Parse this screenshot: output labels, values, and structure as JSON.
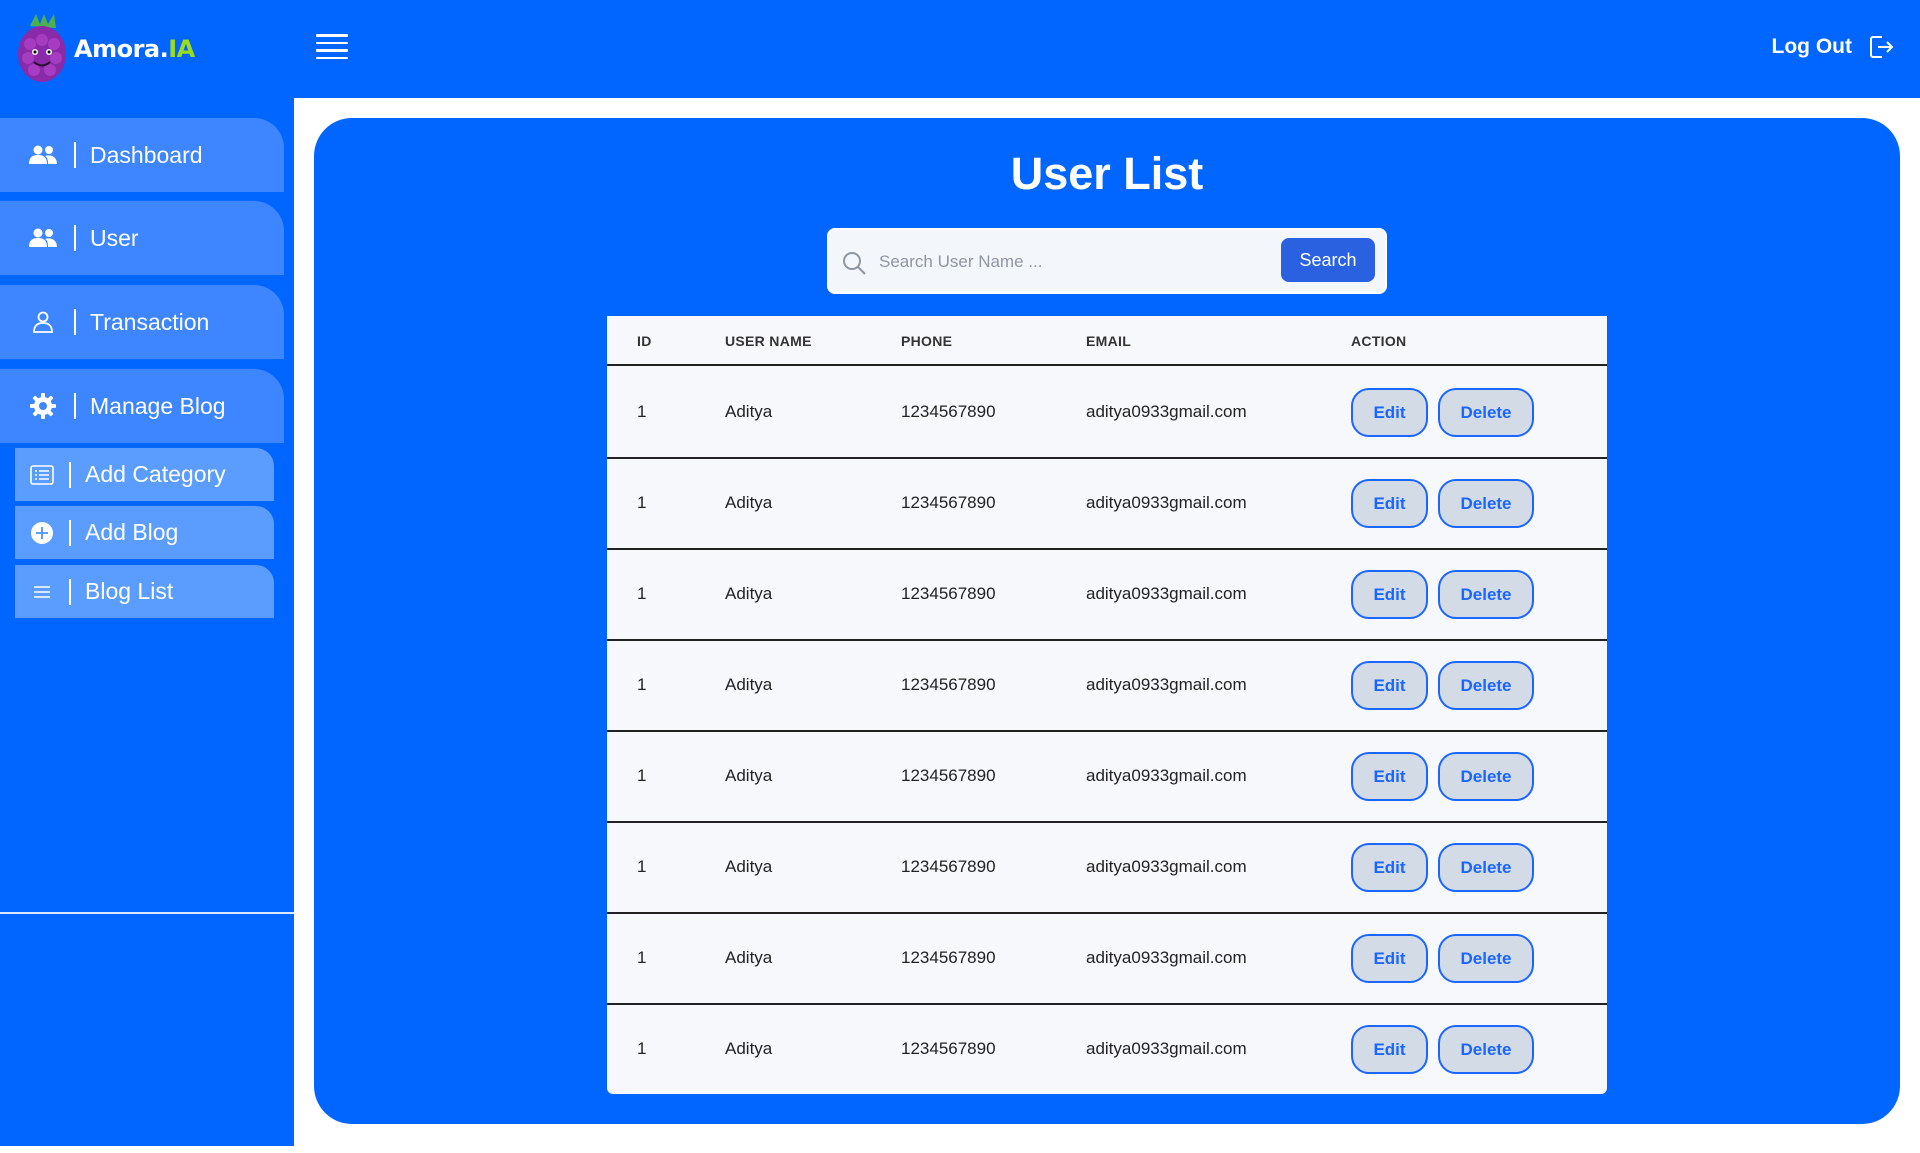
{
  "app": {
    "name_main": "Amora.",
    "name_accent": "IA"
  },
  "header": {
    "logout_label": "Log Out"
  },
  "sidebar": {
    "items": [
      {
        "label": "Dashboard",
        "icon": "users-icon"
      },
      {
        "label": "User",
        "icon": "users-icon"
      },
      {
        "label": "Transaction",
        "icon": "user-icon"
      },
      {
        "label": "Manage Blog",
        "icon": "gear-icon"
      }
    ],
    "sub_items": [
      {
        "label": "Add Category",
        "icon": "list-box-icon"
      },
      {
        "label": "Add Blog",
        "icon": "plus-circle-icon"
      },
      {
        "label": "Blog List",
        "icon": "menu-lines-icon"
      }
    ]
  },
  "main": {
    "title": "User List",
    "search": {
      "placeholder": "Search User Name ...",
      "value": "",
      "button_label": "Search"
    },
    "table": {
      "columns": [
        "ID",
        "USER NAME",
        "PHONE",
        "EMAIL",
        "ACTION"
      ],
      "rows": [
        {
          "id": "1",
          "name": "Aditya",
          "phone": "1234567890",
          "email": "aditya0933gmail.com"
        },
        {
          "id": "1",
          "name": "Aditya",
          "phone": "1234567890",
          "email": "aditya0933gmail.com"
        },
        {
          "id": "1",
          "name": "Aditya",
          "phone": "1234567890",
          "email": "aditya0933gmail.com"
        },
        {
          "id": "1",
          "name": "Aditya",
          "phone": "1234567890",
          "email": "aditya0933gmail.com"
        },
        {
          "id": "1",
          "name": "Aditya",
          "phone": "1234567890",
          "email": "aditya0933gmail.com"
        },
        {
          "id": "1",
          "name": "Aditya",
          "phone": "1234567890",
          "email": "aditya0933gmail.com"
        },
        {
          "id": "1",
          "name": "Aditya",
          "phone": "1234567890",
          "email": "aditya0933gmail.com"
        },
        {
          "id": "1",
          "name": "Aditya",
          "phone": "1234567890",
          "email": "aditya0933gmail.com"
        }
      ],
      "edit_label": "Edit",
      "delete_label": "Delete"
    }
  },
  "colors": {
    "primary": "#0066ff",
    "nav_item": "#3d86ff",
    "sub_item": "#5b9dff",
    "accent": "#9bdc1e",
    "search_button": "#2a61e0"
  }
}
